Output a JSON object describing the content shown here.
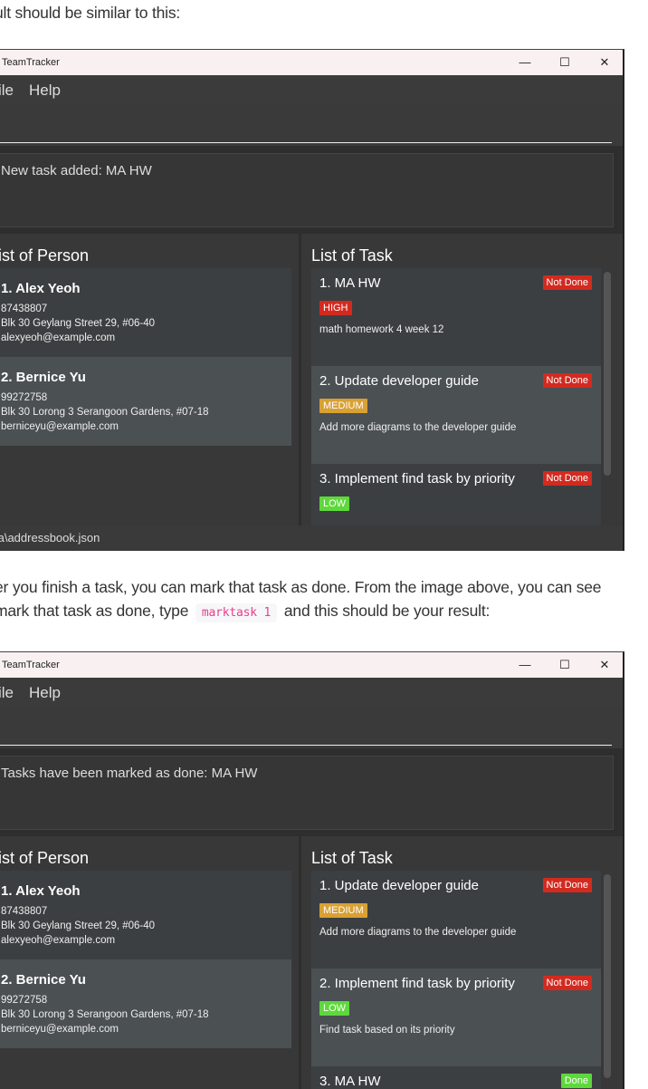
{
  "doc": {
    "para1": "ult should be similar to this:",
    "para2_line1": "er you finish a task, you can mark that task as done. From the image above, you can see",
    "para2_line2_before": "mark that task as done, type",
    "para2_code": "marktask 1",
    "para2_line2_after": "and this should be your result:"
  },
  "colors": {
    "high": "#d32a20",
    "medium": "#d9a032",
    "low": "#5ed83c",
    "not_done": "#d32a20",
    "done": "#5ed83c",
    "card_even": "#3c3f41",
    "card_odd": "#4b5053"
  },
  "windows": [
    {
      "title": "TeamTracker",
      "controls": [
        "—",
        "☐",
        "✕"
      ],
      "menu": [
        "ile",
        "Help"
      ],
      "command_value": "",
      "result": "New task added: MA HW",
      "person_header": "ist of Person",
      "task_header": "List of Task",
      "persons": [
        {
          "name": "1.  Alex Yeoh",
          "phone": "87438807",
          "address": "Blk 30 Geylang Street 29, #06-40",
          "email": "alexyeoh@example.com"
        },
        {
          "name": "2.  Bernice Yu",
          "phone": "99272758",
          "address": "Blk 30 Lorong 3 Serangoon Gardens, #07-18",
          "email": "berniceyu@example.com"
        }
      ],
      "tasks": [
        {
          "name": "1. MA HW",
          "status": "Not Done",
          "priority": "HIGH",
          "description": "math homework 4 week 12"
        },
        {
          "name": "2. Update developer guide",
          "status": "Not Done",
          "priority": "MEDIUM",
          "description": "Add more diagrams to the developer guide"
        },
        {
          "name": "3. Implement find task by priority",
          "status": "Not Done",
          "priority": "LOW",
          "description": ""
        }
      ],
      "status_bar": "ta\\addressbook.json"
    },
    {
      "title": "TeamTracker",
      "controls": [
        "—",
        "☐",
        "✕"
      ],
      "menu": [
        "ile",
        "Help"
      ],
      "command_value": "",
      "result": "Tasks have been marked as done: MA HW",
      "person_header": "ist of Person",
      "task_header": "List of Task",
      "persons": [
        {
          "name": "1.  Alex Yeoh",
          "phone": "87438807",
          "address": "Blk 30 Geylang Street 29, #06-40",
          "email": "alexyeoh@example.com"
        },
        {
          "name": "2.  Bernice Yu",
          "phone": "99272758",
          "address": "Blk 30 Lorong 3 Serangoon Gardens, #07-18",
          "email": "berniceyu@example.com"
        }
      ],
      "tasks": [
        {
          "name": "1. Update developer guide",
          "status": "Not Done",
          "priority": "MEDIUM",
          "description": "Add more diagrams to the developer guide"
        },
        {
          "name": "2. Implement find task by priority",
          "status": "Not Done",
          "priority": "LOW",
          "description": "Find task based on its priority"
        },
        {
          "name": "3. MA HW",
          "status": "Done",
          "priority": "",
          "description": ""
        }
      ],
      "status_bar": ""
    }
  ]
}
